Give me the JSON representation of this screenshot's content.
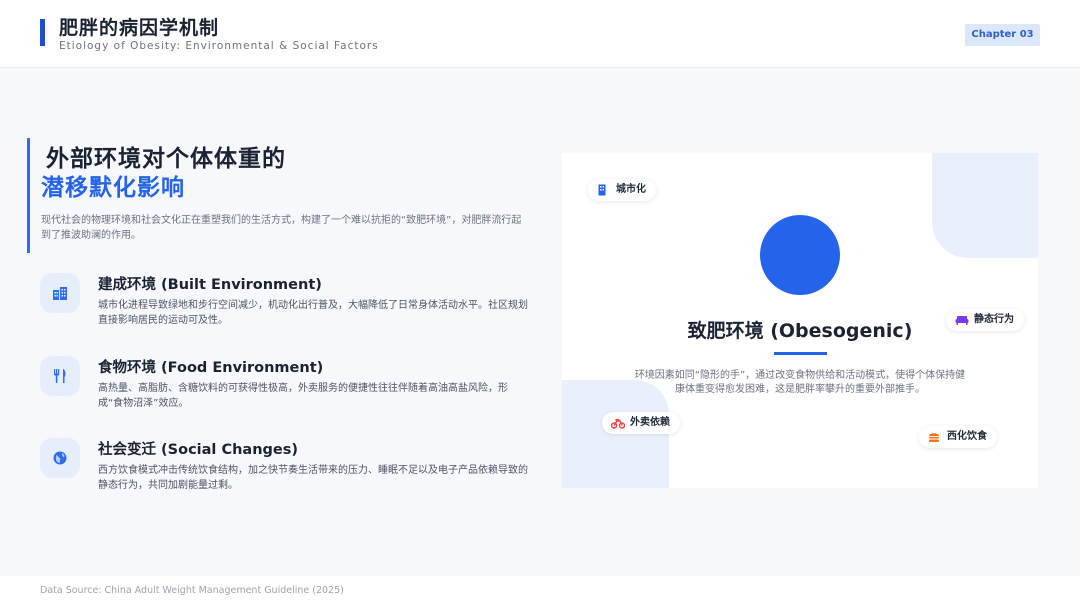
{
  "header": {
    "title": "肥胖的病因学机制",
    "subtitle": "Etiology of Obesity: Environmental & Social Factors",
    "chapter": "Chapter 03"
  },
  "hero": {
    "line1": "外部环境对个体体重的",
    "line2": "潜移默化影响",
    "description": "现代社会的物理环境和社会文化正在重塑我们的生活方式，构建了一个难以抗拒的“致肥环境”，对肥胖流行起到了推波助澜的作用。"
  },
  "factors": [
    {
      "icon": "buildings-icon",
      "title": "建成环境 (Built Environment)",
      "text": "城市化进程导致绿地和步行空间减少，机动化出行普及，大幅降低了日常身体活动水平。社区规划直接影响居民的运动可及性。"
    },
    {
      "icon": "utensils-icon",
      "title": "食物环境 (Food Environment)",
      "text": "高热量、高脂肪、含糖饮料的可获得性极高，外卖服务的便捷性往往伴随着高油高盐风险，形成“食物沼泽”效应。"
    },
    {
      "icon": "globe-icon",
      "title": "社会变迁 (Social Changes)",
      "text": "西方饮食模式冲击传统饮食结构，加之快节奏生活带来的压力、睡眠不足以及电子产品依赖导致的静态行为，共同加剧能量过剩。"
    }
  ],
  "diagram": {
    "title": "致肥环境 (Obesogenic)",
    "description": "环境因素如同“隐形的手”，通过改变食物供给和活动模式，使得个体保持健康体重变得愈发困难，这是肥胖率攀升的重要外部推手。",
    "tags": {
      "urbanization": {
        "label": "城市化",
        "icon": "building-icon"
      },
      "sedentary": {
        "label": "静态行为",
        "icon": "couch-icon"
      },
      "delivery": {
        "label": "外卖依赖",
        "icon": "motorcycle-icon"
      },
      "western_diet": {
        "label": "西化饮食",
        "icon": "burger-icon"
      }
    }
  },
  "footer": {
    "source": "Data Source: China Adult Weight Management Guideline (2025)"
  },
  "colors": {
    "accent": "#2563eb",
    "accent_dark": "#1f4fd0",
    "badge_bg": "#dce7fb",
    "icon_bg": "#e6eefc",
    "tag_purple": "#7c3aed",
    "tag_red": "#ef4444",
    "tag_orange": "#f97316"
  }
}
